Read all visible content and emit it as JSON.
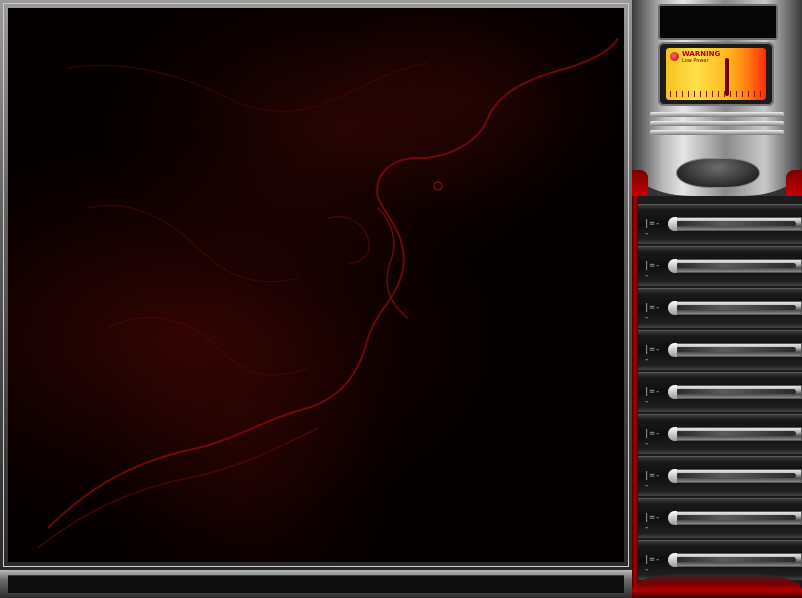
{
  "map": {
    "name": "tactical-map",
    "fog": "partially-revealed",
    "accent_color": "#8b0d0d"
  },
  "radar": {
    "warning_title": "WARNING",
    "warning_subtitle": "Low Power",
    "screen_colors": [
      "#f6c21e",
      "#ff7a10",
      "#ff2a0a"
    ],
    "needle_level": 0.62
  },
  "status_bar": {
    "text": ""
  },
  "sidebar": {
    "slots": [
      {
        "id": "slot-1",
        "glyph": "|=--"
      },
      {
        "id": "slot-2",
        "glyph": "|=--"
      },
      {
        "id": "slot-3",
        "glyph": "|=--"
      },
      {
        "id": "slot-4",
        "glyph": "|=--"
      },
      {
        "id": "slot-5",
        "glyph": "|=--"
      },
      {
        "id": "slot-6",
        "glyph": "|=--"
      },
      {
        "id": "slot-7",
        "glyph": "|=--"
      },
      {
        "id": "slot-8",
        "glyph": "|=--"
      },
      {
        "id": "slot-9",
        "glyph": "|=--"
      }
    ]
  }
}
